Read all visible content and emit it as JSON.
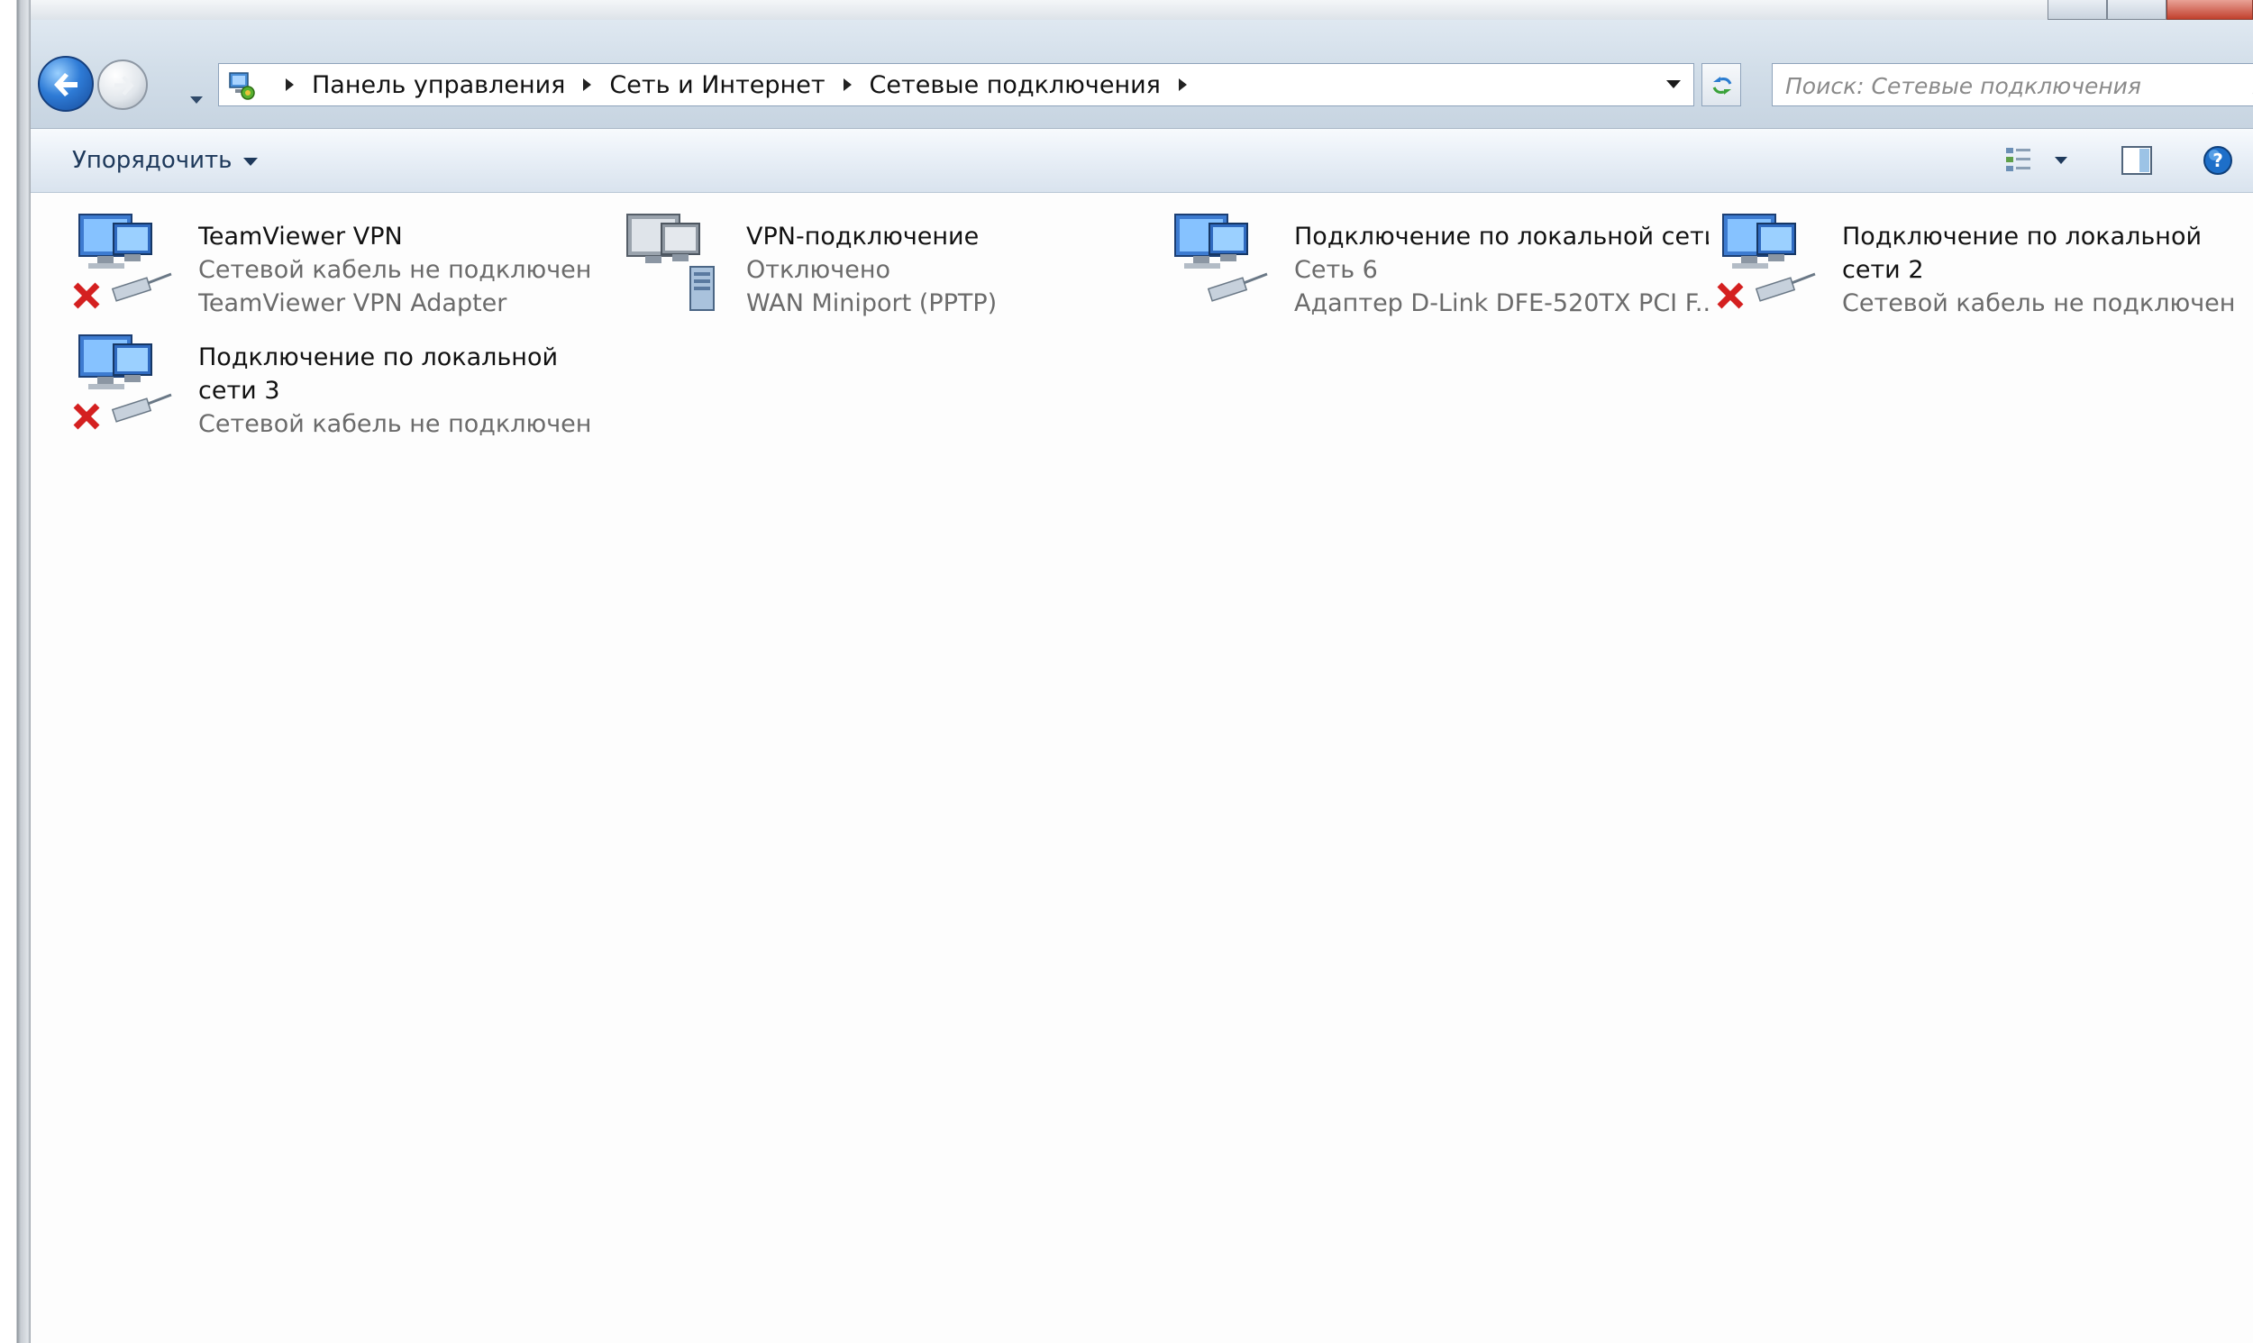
{
  "address_bar": {
    "breadcrumbs": [
      "Панель управления",
      "Сеть и Интернет",
      "Сетевые подключения"
    ]
  },
  "search": {
    "placeholder": "Поиск: Сетевые подключения"
  },
  "command_bar": {
    "organize_label": "Упорядочить"
  },
  "connections": [
    {
      "name": "TeamViewer VPN",
      "status": "Сетевой кабель не подключен",
      "device": "TeamViewer VPN Adapter",
      "icon": "lan-connection-icon",
      "state": "cable-unplugged"
    },
    {
      "name": "VPN-подключение",
      "status": "Отключено",
      "device": "WAN Miniport (PPTP)",
      "icon": "vpn-connection-icon",
      "state": "disconnected"
    },
    {
      "name": "Подключение по локальной сети",
      "status": "Сеть 6",
      "device": "Адаптер D-Link DFE-520TX PCI F...",
      "icon": "lan-connection-icon",
      "state": "connected"
    },
    {
      "name": "Подключение по локальной сети 2",
      "status": "Сетевой кабель не подключен",
      "device": "",
      "icon": "lan-connection-icon",
      "state": "cable-unplugged"
    },
    {
      "name": "Подключение по локальной сети 3",
      "status": "Сетевой кабель не подключен",
      "device": "",
      "icon": "lan-connection-icon",
      "state": "cable-unplugged"
    }
  ],
  "colors": {
    "accent_blue": "#2e7bd6",
    "error_red": "#d42020",
    "secondary_text": "#6b6b6b"
  }
}
